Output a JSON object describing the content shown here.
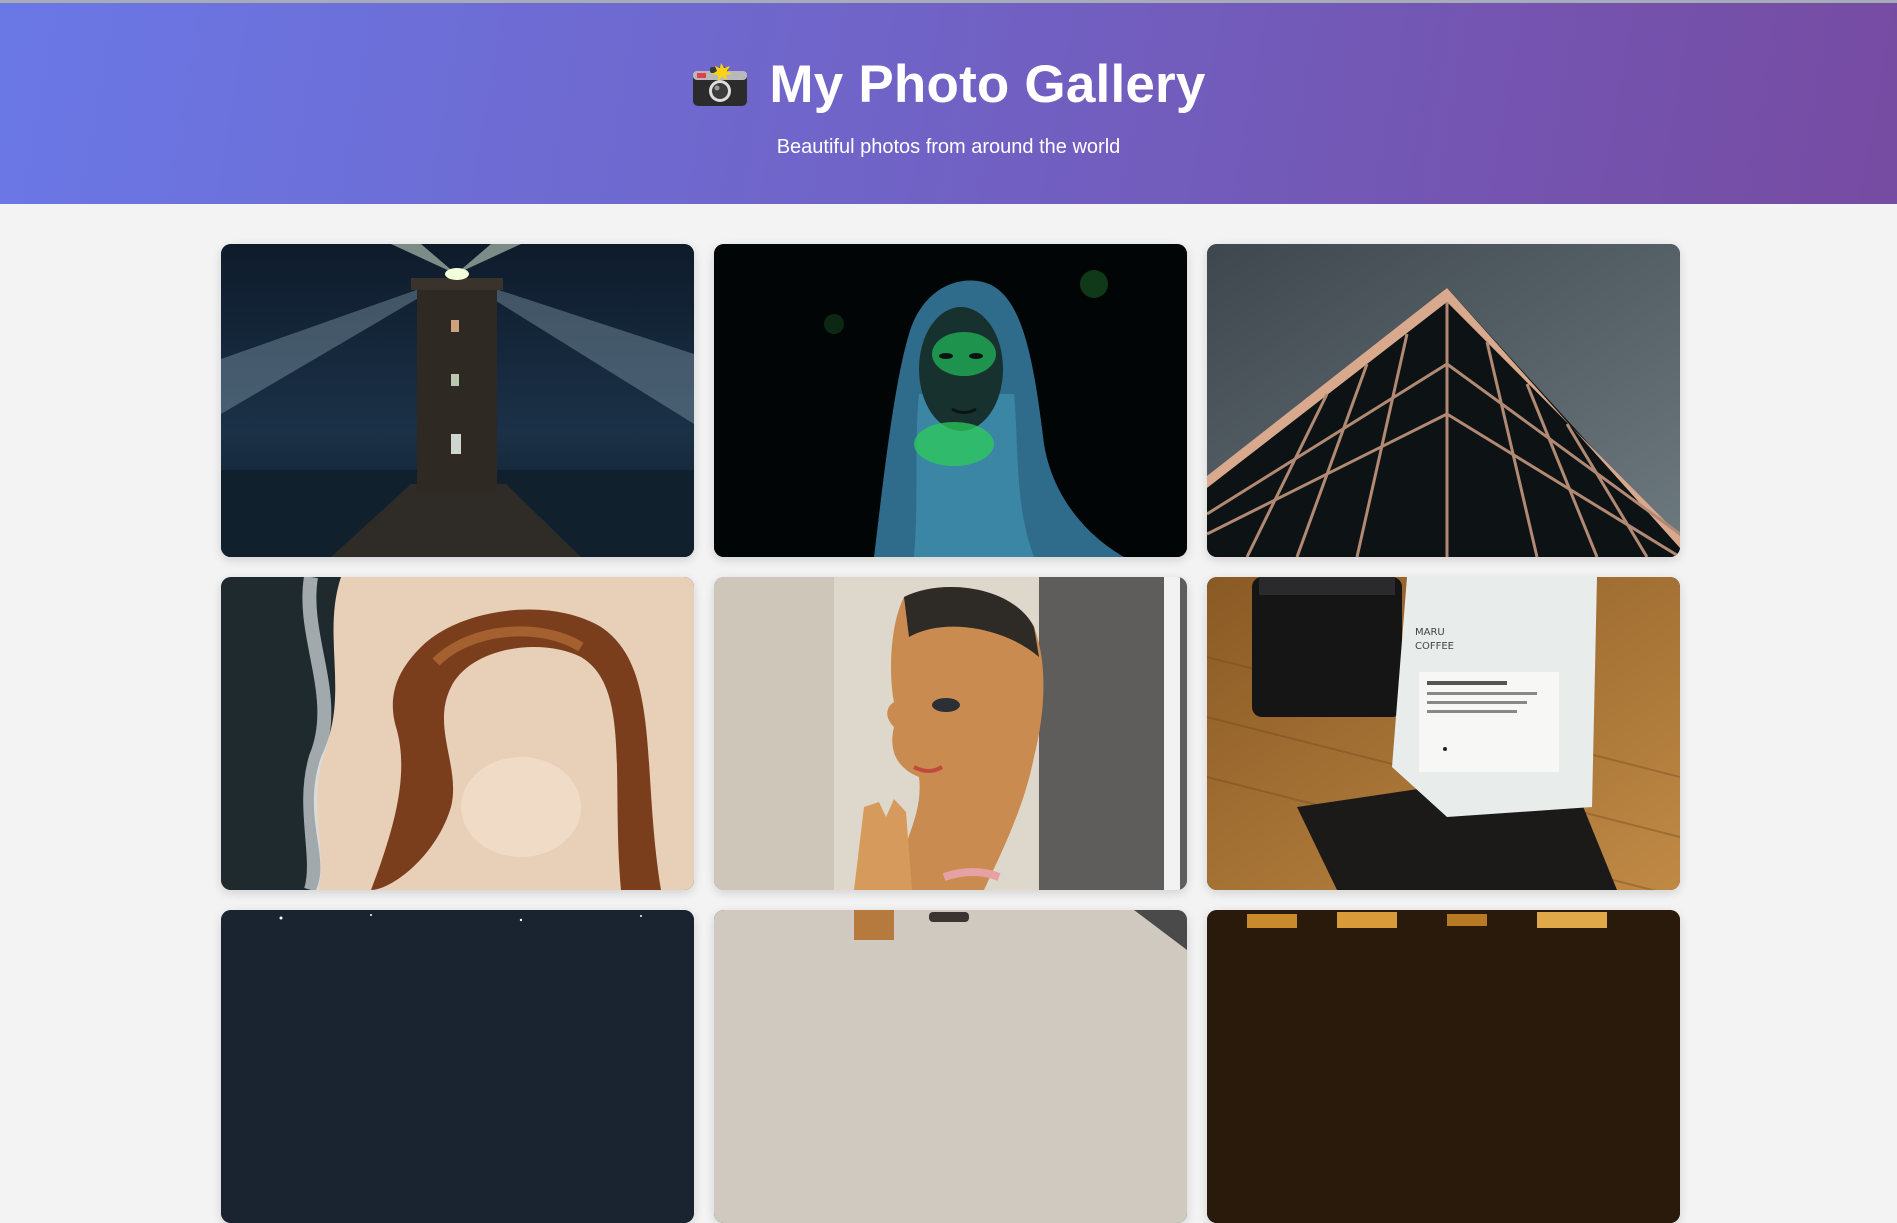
{
  "header": {
    "icon": "camera-icon",
    "title": "My Photo Gallery",
    "subtitle": "Beautiful photos from around the world"
  },
  "colors": {
    "gradient_start": "#6a78e6",
    "gradient_end": "#764ba2",
    "page_background": "#f3f3f3"
  },
  "gallery": {
    "photos": [
      {
        "name": "lighthouse-night-photo"
      },
      {
        "name": "green-light-face-photo"
      },
      {
        "name": "glass-building-corner-photo"
      },
      {
        "name": "aerial-beach-photo"
      },
      {
        "name": "wooden-statue-praying-photo"
      },
      {
        "name": "coffee-bag-drink-photo"
      },
      {
        "name": "starry-sky-photo"
      },
      {
        "name": "interior-lamp-photo"
      },
      {
        "name": "warm-lights-photo"
      }
    ]
  }
}
